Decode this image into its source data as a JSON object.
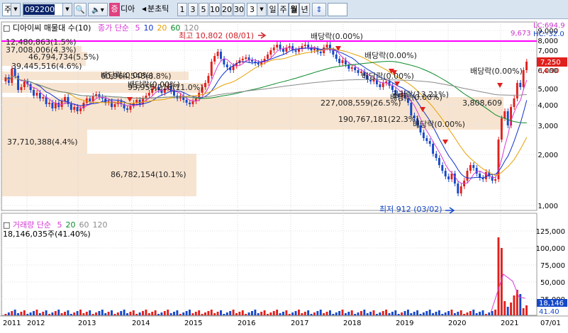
{
  "toolbar": {
    "market_select": "주",
    "code_input": "092200",
    "stock_name": "디아",
    "prefix_badge": "증",
    "period_type": "분초틱",
    "minute_buttons": [
      "1",
      "3",
      "5",
      "10",
      "20",
      "30"
    ],
    "period_value": "3",
    "periods": [
      "일",
      "주",
      "월",
      "년"
    ],
    "selected_period": "월"
  },
  "price_panel": {
    "title": "디아이씨 매물대 수(10)",
    "ma_title": "종가 단순",
    "ma_periods": [
      "5",
      "10",
      "20",
      "60",
      "120"
    ],
    "ma_colors": [
      "#d63ad6",
      "#1133cc",
      "#e6a000",
      "#0a8a2a",
      "#8a8a8a"
    ],
    "right_top_labels": [
      "LC:694.9",
      "HC:-32.0"
    ],
    "right_top_value": "9,673",
    "current_price": "7,250",
    "current_pct": "14.90",
    "high_label": "최고 10,802 (08/01)",
    "low_label": "최저 912 (03/02)",
    "y_ticks": [
      "9,000",
      "8,000",
      "7,000",
      "6,000",
      "5,000",
      "4,000",
      "3,000",
      "2,000",
      "1,000"
    ],
    "dividend_labels": [
      "배당락(0.00%)",
      "배당락(0.00%)",
      "배당락(0.00%)",
      "배당락(0.00%)",
      "배당락(0.00%)",
      "배당락(0.00%)",
      "배당락(0.00%)",
      "배당락(0.00%)",
      "권리락(13.21%)"
    ],
    "volume_profile": [
      "12,480,863(1.5%)",
      "37,008,006(4.3%)",
      "46,794,734(5.5%)",
      "39,445,516(4.6%)",
      "60,964,548(8.8%)",
      "93,955,218(11.0%)",
      "227,008,559(26.5%)",
      "3,808,609",
      "190,767,181(22.3%)",
      "37,710,388(4.4%)",
      "86,782,154(10.1%)"
    ]
  },
  "volume_panel": {
    "title": "거래량 단순",
    "ma_periods": [
      "5",
      "20",
      "60",
      "120"
    ],
    "current_volume": "18,146,035주(41.40%)",
    "right_value": "18,146",
    "right_pct": "41.40",
    "y_ticks": [
      "125,000",
      "100,000",
      "75,000",
      "50,000",
      "25,000"
    ]
  },
  "x_axis": [
    "2011",
    "2012",
    "2013",
    "2014",
    "2015",
    "2016",
    "2017",
    "2018",
    "2019",
    "2020",
    "2021",
    "07/01"
  ],
  "colors": {
    "up": "#e0201c",
    "down": "#1548c8",
    "highlight_line": "#ff00ff",
    "volume_profile": "#f7e4d0"
  }
}
